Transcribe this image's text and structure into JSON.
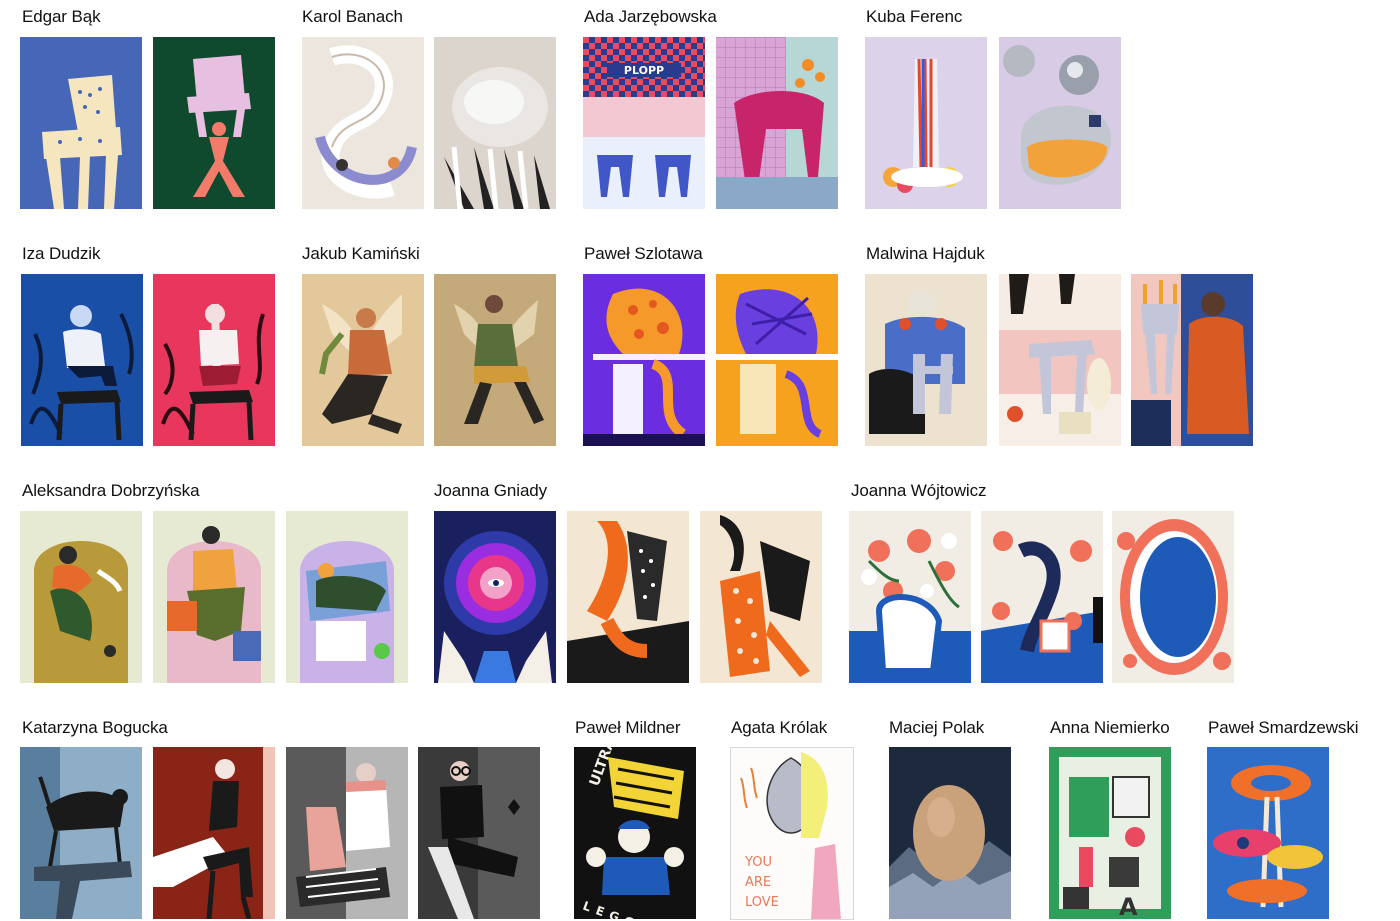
{
  "artists": [
    {
      "name": "Edgar Bąk"
    },
    {
      "name": "Karol Banach"
    },
    {
      "name": "Ada Jarzębowska"
    },
    {
      "name": "Kuba Ferenc"
    },
    {
      "name": "Iza Dudzik"
    },
    {
      "name": "Jakub Kamiński"
    },
    {
      "name": "Paweł Szlotawa"
    },
    {
      "name": "Malwina Hajduk"
    },
    {
      "name": "Aleksandra Dobrzyńska"
    },
    {
      "name": "Joanna Gniady"
    },
    {
      "name": "Joanna Wójtowicz"
    },
    {
      "name": "Katarzyna Bogucka"
    },
    {
      "name": "Paweł Mildner"
    },
    {
      "name": "Agata Królak"
    },
    {
      "name": "Maciej Polak"
    },
    {
      "name": "Anna Niemierko"
    },
    {
      "name": "Paweł Smardzewski"
    }
  ],
  "poster_text": {
    "plopp": "PLOPP",
    "ultra": "ULTRA",
    "leggera": "LEGGERA",
    "you": "YOU",
    "are": "ARE",
    "love": "LOVE"
  }
}
